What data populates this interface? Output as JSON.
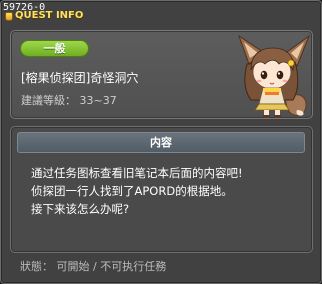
{
  "window": {
    "quest_id": "59726-0",
    "title": "QUEST INFO",
    "title_color": "#ffe060",
    "background": "#414141"
  },
  "summary": {
    "category": "一般",
    "category_color": "#8cc83a",
    "quest_name": "[榕果侦探团]奇怪洞穴",
    "recommended_level": "建議等級： 33~37"
  },
  "content": {
    "header": "内容",
    "lines": [
      "通过任务图标查看旧笔记本后面的内容吧!",
      "侦探团一行人找到了APORD的根据地。",
      "接下来该怎么办呢?"
    ]
  },
  "status": {
    "text": "狀態： 可開始 / 不可执行任務"
  }
}
